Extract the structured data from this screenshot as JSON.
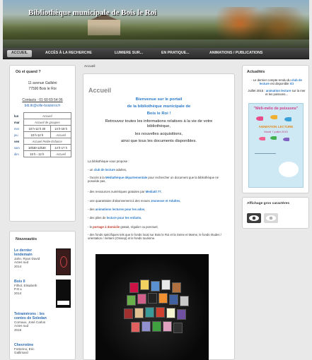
{
  "header": {
    "title": "Bibliothèque municipale de Bois le Roi"
  },
  "nav": [
    {
      "label": "ACCUEIL"
    },
    {
      "label": "ACCÈS À LA RECHERCHE"
    },
    {
      "label": "LUMIERE SUR..."
    },
    {
      "label": "EN PRATIQUE..."
    },
    {
      "label": "ANIMATIONS / PUBLICATIONS"
    }
  ],
  "left": {
    "title": "Où et quand ?",
    "address1": "11 avenue Galliéni",
    "address2": "77590 Bois le Roi",
    "contact": "Contacts : 01 60 69 54 06",
    "email": "bib.ltr@ville-boisleroi.fr",
    "hours": [
      {
        "day": "lun",
        "a": "Accueil",
        "b": ""
      },
      {
        "day": "mar",
        "a": "Accueil de groupes",
        "b": ""
      },
      {
        "day": "mer",
        "a": "10 h-12 h 30",
        "b": "14 h-18 h"
      },
      {
        "day": "jeu",
        "a": "10 h-12 h",
        "b": "Accueil"
      },
      {
        "day": "ven",
        "a": "Accueil Petite-Enfance",
        "b": ""
      },
      {
        "day": "sam",
        "a": "10h30-12h30",
        "b": "14 h-17 h"
      },
      {
        "day": "dim",
        "a": "10 h - 12 h",
        "b": "Accueil"
      }
    ]
  },
  "nouv": {
    "title": "Nouveautés",
    "books": [
      {
        "title1": "Le dernier",
        "title2": "lendemain",
        "meta1": "Jahn, Ryan David",
        "meta2": "Actes sud",
        "meta3": "2014"
      },
      {
        "title1": "Bois II",
        "title2": "",
        "meta1": "Filhol, Elisabeth",
        "meta2": "P.O.L",
        "meta3": "2014"
      },
      {
        "title1": "Tetramérons : les",
        "title2": "contes de Soledan",
        "meta1": "Cornaux, José Carlos",
        "meta2": "Actes sud",
        "meta3": "2015"
      },
      {
        "title1": "Chevrotine",
        "title2": "",
        "meta1": "Fottorino, Eric",
        "meta2": "Gallimard",
        "meta3": ""
      }
    ]
  },
  "main": {
    "breadcrumb": "Accueil",
    "heading": "Accueil",
    "welcome1": "Bienvenue sur le portail",
    "welcome2": "de la bibliothèque municipale de",
    "welcome3": "Bois le Roi !",
    "intro1": "Retrouvez toutes les informations relatives à la vie de votre",
    "intro2": "bibliothèque,",
    "intro3": "les nouvelles acquisitions,",
    "intro4": "ainsi que tous les documents disponibles.",
    "propose": "La bibliothèque vous propose :",
    "items": [
      {
        "pre": "- un ",
        "hl": "club de lecture",
        "post": " adultes,"
      },
      {
        "pre": "- l'accès à la ",
        "hl": "Médiathèque départementale",
        "post": " pour rechercher un document que la bibliothèque ne possède pas,"
      },
      {
        "pre": "- des ressources numériques gratuites par ",
        "hl": "Mediatil 77",
        "post": ","
      },
      {
        "pre": "- une quarantaine d'abonnement à des revues ",
        "hl": "Jeunesse et Adultes",
        "post": ","
      },
      {
        "pre": "- des ",
        "hl": "animations lectures pour les ados",
        "post": ","
      },
      {
        "pre": "- des piles de ",
        "hl": "lecture pour les enfants",
        "post": ","
      },
      {
        "pre": "- le ",
        "hl": "portage à domicile",
        "post": " gratuit, régulier ou ponctuel,"
      },
      {
        "pre": "- des fonds spécifiques tels que le fonds local sur Bois le Roi et la Seine et Marne, le fonds études / orientation / métiers (Onisep) et le fonds tourisme.",
        "hl": "",
        "post": ""
      }
    ]
  },
  "actu": {
    "title": "Actualités",
    "line1a": "- Le dernier compte-rendu du ",
    "line1b": "club de lecture",
    "line1c": " est disponible ",
    "line1d": "ICI",
    "line2a": "Juillet 2015 : ",
    "line2b": "animation lecture",
    "line2c": " sur la mer et les poissons...",
    "poster_title": "\"Méli-mélo de poissons\"",
    "poster_sub": "ANIMATION LECTURE",
    "poster_date": "Mardi 7 juillet 2015"
  },
  "gros": {
    "title": "Affichage gros caractères"
  },
  "colors": {
    "accent": "#2a79c8",
    "nav": "#333333"
  }
}
